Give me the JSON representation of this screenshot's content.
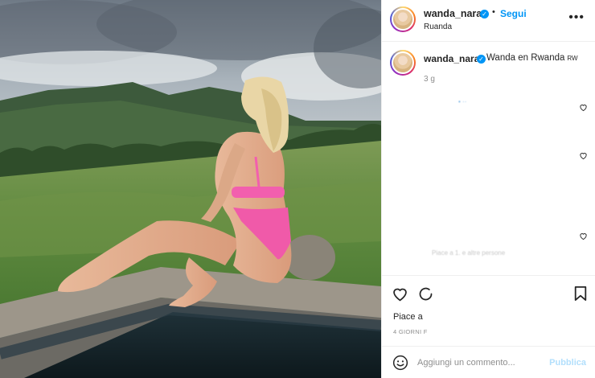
{
  "post": {
    "username": "wanda_nara",
    "follow_label": "Segui",
    "location": "Ruanda",
    "more_icon": "more-icon"
  },
  "caption": {
    "username": "wanda_nara",
    "text": "Wanda en Rwanda",
    "flag_text": "RW",
    "time": "3 g"
  },
  "comments": {
    "blurred_line": "Piace a 1. e altre persone"
  },
  "engagement": {
    "likes_text": "Piace a",
    "date": "4 GIORNI F"
  },
  "comment_bar": {
    "placeholder": "Aggiungi un commento...",
    "publish_label": "Pubblica"
  },
  "colors": {
    "accent": "#0095f6",
    "publish_disabled": "#b2dffc",
    "muted": "#8e8e8e",
    "border": "#efefef"
  }
}
